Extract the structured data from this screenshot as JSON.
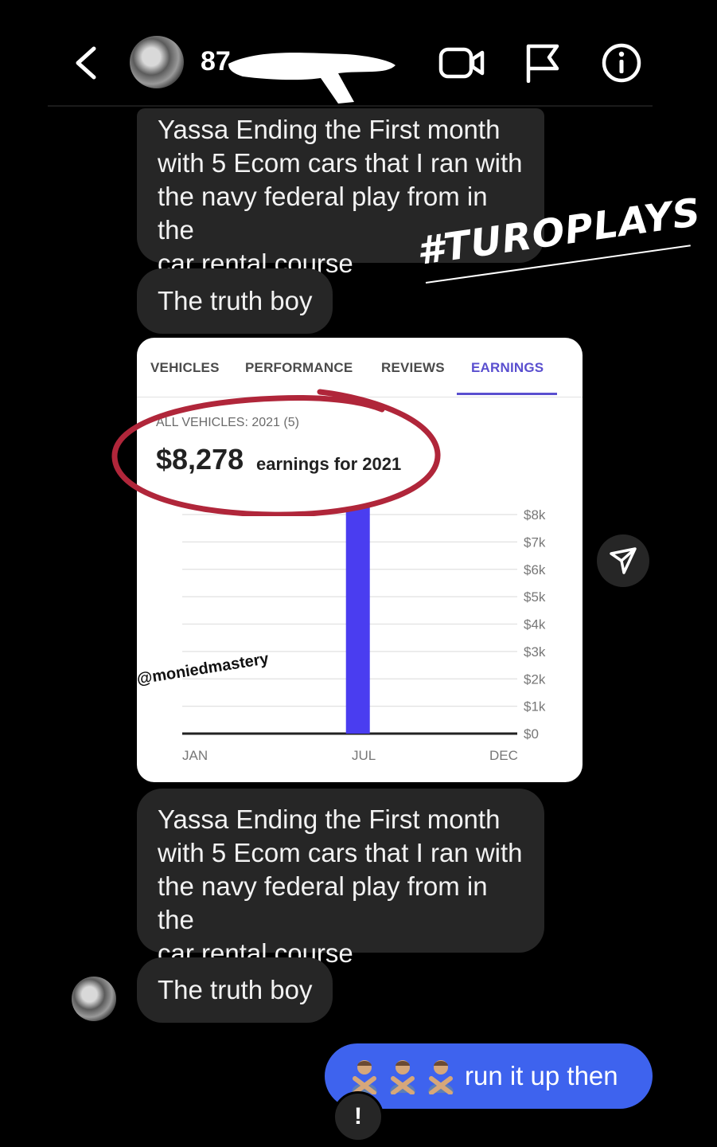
{
  "header": {
    "contact_name": "87",
    "icons": [
      "back-arrow-icon",
      "video-call-icon",
      "flag-icon",
      "info-icon"
    ]
  },
  "messages": [
    {
      "text_lines": [
        "Yassa Ending the First month",
        "with 5 Ecom cars that I ran with",
        "the navy federal play from in the",
        "car rental course"
      ]
    },
    {
      "text": "The truth boy"
    },
    {
      "text_lines": [
        "Yassa Ending the First month",
        "with 5 Ecom cars that I ran with",
        "the navy federal play from in the",
        "car rental course"
      ]
    },
    {
      "text": "The truth boy"
    }
  ],
  "sticker": "#TUROPLAYS",
  "earnings_card": {
    "tabs": [
      "VEHICLES",
      "PERFORMANCE",
      "REVIEWS",
      "EARNINGS"
    ],
    "active_tab": "EARNINGS",
    "subhead": "ALL VEHICLES: 2021 (5)",
    "total": "$8,278",
    "total_suffix": "earnings for 2021",
    "watermark": "@moniedmastery"
  },
  "chart_data": {
    "type": "bar",
    "categories": [
      "JAN",
      "JUL",
      "DEC"
    ],
    "x_tick_labels": [
      "JAN",
      "JUL",
      "DEC"
    ],
    "y_tick_labels": [
      "$8k",
      "$7k",
      "$6k",
      "$5k",
      "$4k",
      "$3k",
      "$2k",
      "$1k",
      "$0"
    ],
    "ylim": [
      0,
      8000
    ],
    "bars": [
      {
        "month_index": 6,
        "value": 8278
      }
    ],
    "grid": true,
    "bar_color": "#4a3df0"
  },
  "outbound_message": {
    "emoji": [
      "person-gesturing-no-emoji",
      "person-gesturing-no-emoji",
      "person-gesturing-no-emoji"
    ],
    "text": "run it up then"
  },
  "reaction": "!",
  "colors": {
    "background": "#000000",
    "bubble": "#262626",
    "outbound": "#3e63ee",
    "accent": "#5a4fcf",
    "circle_annotation": "#b0263a"
  }
}
